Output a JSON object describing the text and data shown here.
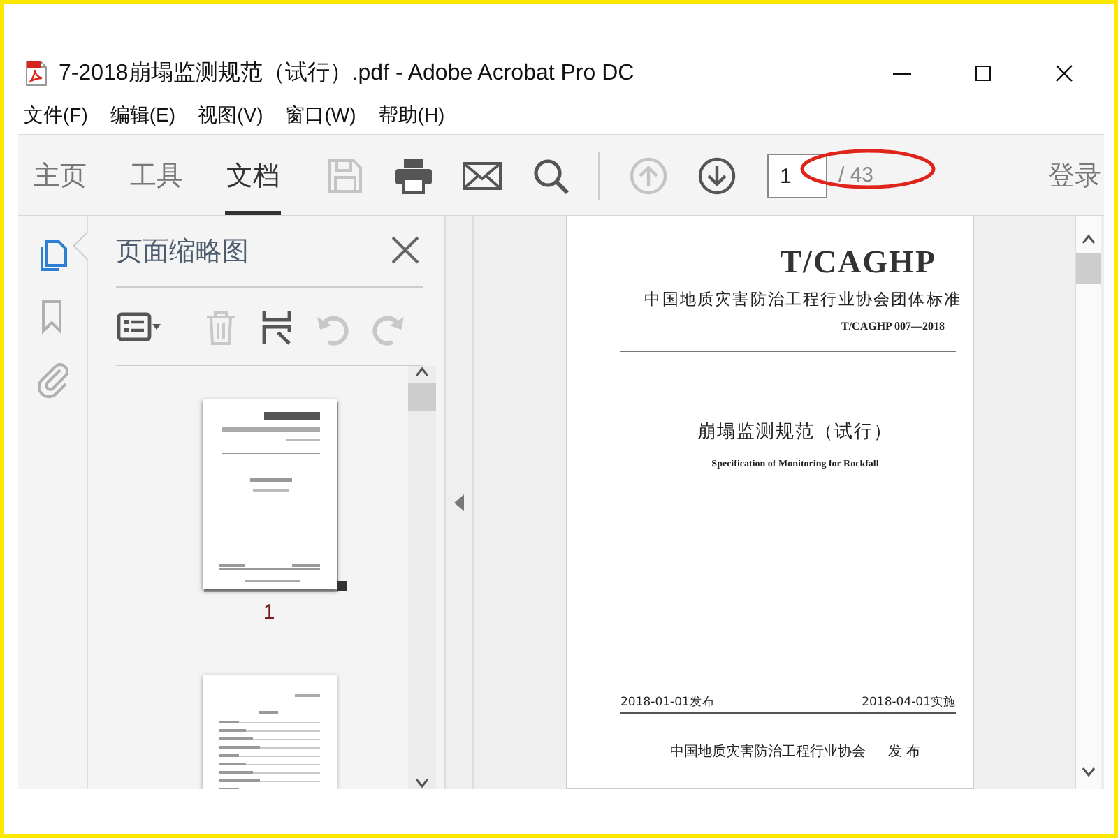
{
  "window": {
    "title": "7-2018崩塌监测规范（试行）.pdf - Adobe Acrobat Pro DC"
  },
  "menu": [
    "文件(F)",
    "编辑(E)",
    "视图(V)",
    "窗口(W)",
    "帮助(H)"
  ],
  "toolbar": {
    "tabs": [
      {
        "label": "主页",
        "selected": false
      },
      {
        "label": "工具",
        "selected": false
      },
      {
        "label": "文档",
        "selected": true
      }
    ],
    "tools": [
      {
        "kind": "save",
        "disabled": true
      },
      {
        "kind": "print",
        "disabled": false
      },
      {
        "kind": "mail",
        "disabled": false
      },
      {
        "kind": "search",
        "disabled": false
      },
      {
        "kind": "divider"
      },
      {
        "kind": "prev",
        "disabled": true
      },
      {
        "kind": "next",
        "disabled": false
      }
    ],
    "page_field": {
      "value": "1"
    },
    "page_total": "/ 43",
    "sign_in": "登录"
  },
  "nav_rail": [
    {
      "kind": "pages",
      "selected": true
    },
    {
      "kind": "bookmarks",
      "selected": false
    },
    {
      "kind": "attachments",
      "selected": false
    }
  ],
  "thumbnail_panel": {
    "title": "页面缩略图",
    "tools": [
      {
        "kind": "options",
        "disabled": false
      },
      {
        "kind": "divider"
      },
      {
        "kind": "delete",
        "disabled": true
      },
      {
        "kind": "insert",
        "disabled": false
      },
      {
        "kind": "rotate-left",
        "disabled": true
      },
      {
        "kind": "rotate-right",
        "disabled": true
      }
    ],
    "thumbnails": [
      {
        "kind": "cover",
        "label": "1",
        "selected": true
      },
      {
        "kind": "contents",
        "selected": false
      }
    ]
  },
  "document": {
    "code_mark": "T/CAGHP",
    "organization_standard": "中国地质灾害防治工程行业协会团体标准",
    "standard_number": "T/CAGHP 007—2018",
    "title": "崩塌监测规范（试行）",
    "english_title": "Specification of Monitoring for Rockfall",
    "issued": "2018-01-01发布",
    "effective": "2018-04-01实施",
    "publisher": "中国地质灾害防治工程行业协会",
    "publish_word": "发 布"
  }
}
